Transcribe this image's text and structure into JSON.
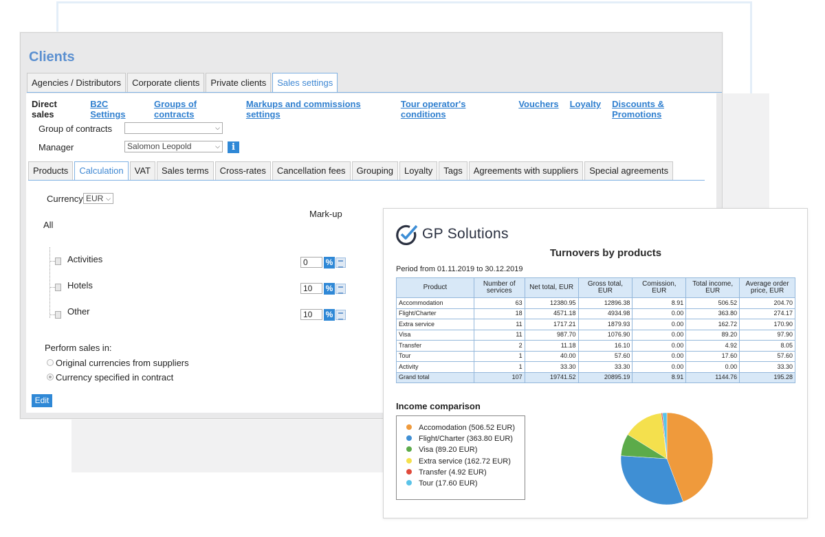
{
  "app": {
    "title": "Clients",
    "top_tabs": [
      "Agencies / Distributors",
      "Corporate clients",
      "Private clients",
      "Sales settings"
    ],
    "sub_links": [
      "Direct sales",
      "B2C Settings",
      "Groups of contracts",
      "Markups and commissions settings",
      "Tour operator's conditions",
      "Vouchers",
      "Loyalty",
      "Discounts & Promotions"
    ],
    "group_of_contracts_label": "Group of contracts",
    "group_of_contracts_value": "",
    "manager_label": "Manager",
    "manager_value": "Salomon Leopold",
    "inner_tabs": [
      "Products",
      "Calculation",
      "VAT",
      "Sales terms",
      "Cross-rates",
      "Cancellation fees",
      "Grouping",
      "Loyalty",
      "Tags",
      "Agreements with suppliers",
      "Special agreements"
    ],
    "currency_label": "Currency",
    "currency_value": "EUR",
    "markup_label": "Mark-up",
    "all_label": "All",
    "products": [
      {
        "name": "Activities",
        "markup": "0"
      },
      {
        "name": "Hotels",
        "markup": "10"
      },
      {
        "name": "Other",
        "markup": "10"
      }
    ],
    "pct_symbol": "%",
    "perform_sales_label": "Perform sales in:",
    "radio_options": [
      "Original currencies from suppliers",
      "Currency specified in contract"
    ],
    "edit_label": "Edit"
  },
  "report": {
    "brand": "GP Solutions",
    "title": "Turnovers by products",
    "period": "Period from 01.11.2019 to 30.12.2019",
    "columns": [
      "Product",
      "Number of services",
      "Net total, EUR",
      "Gross total, EUR",
      "Comission, EUR",
      "Total income, EUR",
      "Average order price, EUR"
    ],
    "rows": [
      [
        "Accommodation",
        "63",
        "12380.95",
        "12896.38",
        "8.91",
        "506.52",
        "204.70"
      ],
      [
        "Flight/Charter",
        "18",
        "4571.18",
        "4934.98",
        "0.00",
        "363.80",
        "274.17"
      ],
      [
        "Extra service",
        "11",
        "1717.21",
        "1879.93",
        "0.00",
        "162.72",
        "170.90"
      ],
      [
        "Visa",
        "11",
        "987.70",
        "1076.90",
        "0.00",
        "89.20",
        "97.90"
      ],
      [
        "Transfer",
        "2",
        "11.18",
        "16.10",
        "0.00",
        "4.92",
        "8.05"
      ],
      [
        "Tour",
        "1",
        "40.00",
        "57.60",
        "0.00",
        "17.60",
        "57.60"
      ],
      [
        "Activity",
        "1",
        "33.30",
        "33.30",
        "0.00",
        "0.00",
        "33.30"
      ]
    ],
    "total_row": [
      "Grand total",
      "107",
      "19741.52",
      "20895.19",
      "8.91",
      "1144.76",
      "195.28"
    ],
    "income_title": "Income comparison",
    "legend": [
      {
        "label": "Accomodation (506.52 EUR)",
        "color": "#ef9a3c"
      },
      {
        "label": "Flight/Charter (363.80 EUR)",
        "color": "#3f8fd4"
      },
      {
        "label": "Visa (89.20 EUR)",
        "color": "#5cab4a"
      },
      {
        "label": "Extra service (162.72 EUR)",
        "color": "#f4e04d"
      },
      {
        "label": "Transfer (4.92 EUR)",
        "color": "#e04a3b"
      },
      {
        "label": "Tour (17.60 EUR)",
        "color": "#5ac3e8"
      }
    ]
  },
  "chart_data": {
    "type": "pie",
    "title": "Income comparison",
    "categories": [
      "Accomodation",
      "Flight/Charter",
      "Visa",
      "Extra service",
      "Transfer",
      "Tour"
    ],
    "values": [
      506.52,
      363.8,
      89.2,
      162.72,
      4.92,
      17.6
    ],
    "colors": [
      "#ef9a3c",
      "#3f8fd4",
      "#5cab4a",
      "#f4e04d",
      "#e04a3b",
      "#5ac3e8"
    ],
    "legend": "left"
  }
}
